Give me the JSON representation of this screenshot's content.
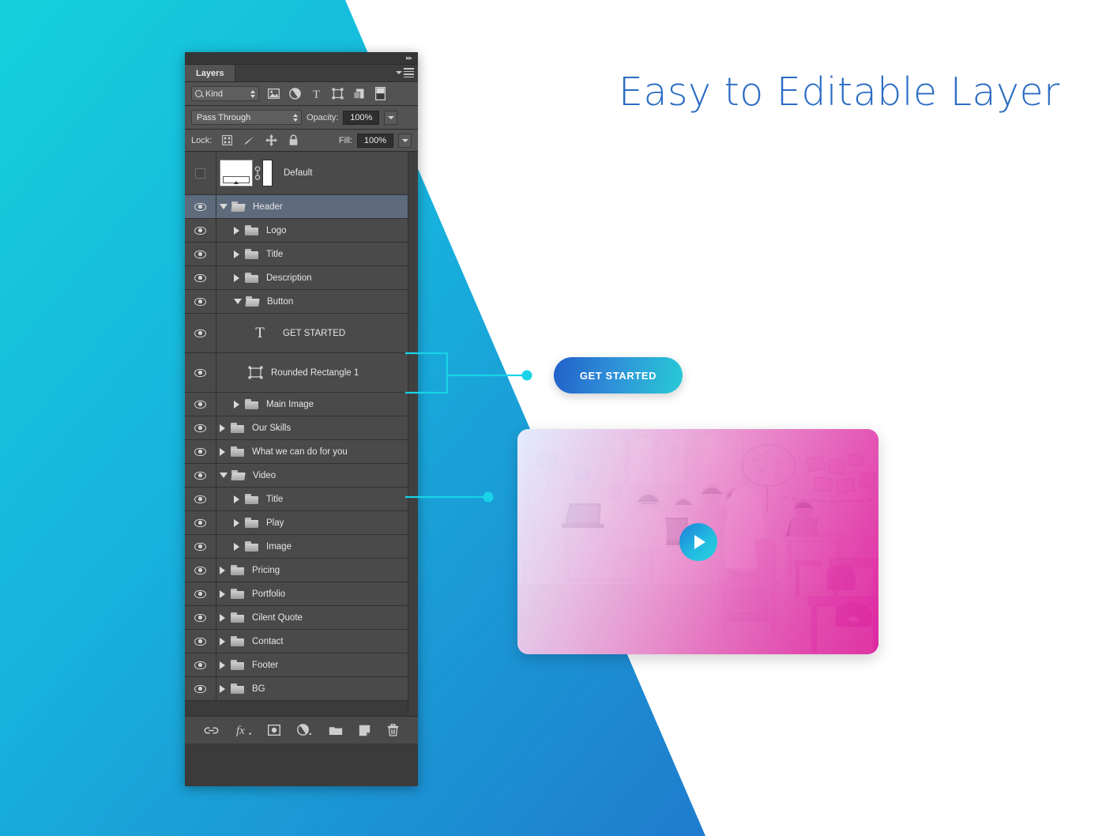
{
  "headline": "Easy to Editable Layer",
  "colors": {
    "accent_cyan": "#1ccfe0",
    "accent_blue": "#1f77cd",
    "headline_blue": "#2b6cc4",
    "panel_bg": "#3b3b3b",
    "row_bg": "#4a4a4a",
    "selected_row": "#5d6b7d",
    "pink": "#e322a0"
  },
  "panel": {
    "tab_label": "Layers",
    "expand_icon": "double-chevron-right-icon",
    "menu_icon": "panel-menu-icon",
    "filter": {
      "search_icon": "search-icon",
      "kind_label": "Kind",
      "stepper_icon": "stepper-arrows-icon",
      "icons": [
        "filter-pixel-icon",
        "filter-adjustment-icon",
        "filter-type-icon",
        "filter-shape-icon",
        "filter-smart-object-icon",
        "filter-toggle-icon"
      ]
    },
    "blend": {
      "mode": "Pass Through",
      "opacity_label": "Opacity:",
      "opacity_value": "100%",
      "dropdown_icon": "chevron-down-icon"
    },
    "lock": {
      "label": "Lock:",
      "icons": [
        "lock-transparent-pixels-icon",
        "lock-image-pixels-icon",
        "lock-position-icon",
        "lock-all-icon"
      ],
      "fill_label": "Fill:",
      "fill_value": "100%"
    },
    "toolbar_icons": [
      "link-layers-icon",
      "layer-style-fx-icon",
      "add-layer-mask-icon",
      "new-adjustment-layer-icon",
      "new-group-icon",
      "new-layer-icon",
      "delete-layer-icon"
    ]
  },
  "layers": [
    {
      "name": "Default",
      "indent": 0,
      "type": "artboard",
      "eye": false,
      "twirl": "none",
      "selected": false,
      "height": "first"
    },
    {
      "name": "Header",
      "indent": 0,
      "type": "group",
      "eye": true,
      "twirl": "open",
      "selected": true,
      "height": "normal"
    },
    {
      "name": "Logo",
      "indent": 1,
      "type": "group",
      "eye": true,
      "twirl": "closed",
      "selected": false,
      "height": "normal"
    },
    {
      "name": "Title",
      "indent": 1,
      "type": "group",
      "eye": true,
      "twirl": "closed",
      "selected": false,
      "height": "normal"
    },
    {
      "name": "Description",
      "indent": 1,
      "type": "group",
      "eye": true,
      "twirl": "closed",
      "selected": false,
      "height": "normal"
    },
    {
      "name": "Button",
      "indent": 1,
      "type": "group",
      "eye": true,
      "twirl": "open",
      "selected": false,
      "height": "normal"
    },
    {
      "name": "GET STARTED",
      "indent": 2,
      "type": "text",
      "eye": true,
      "twirl": "none",
      "selected": false,
      "height": "tall"
    },
    {
      "name": "Rounded Rectangle 1",
      "indent": 2,
      "type": "shape",
      "eye": true,
      "twirl": "none",
      "selected": false,
      "height": "tall"
    },
    {
      "name": "Main Image",
      "indent": 1,
      "type": "group",
      "eye": true,
      "twirl": "closed",
      "selected": false,
      "height": "normal"
    },
    {
      "name": "Our Skills",
      "indent": 0,
      "type": "group",
      "eye": true,
      "twirl": "closed",
      "selected": false,
      "height": "normal"
    },
    {
      "name": "What we can do for you",
      "indent": 0,
      "type": "group",
      "eye": true,
      "twirl": "closed",
      "selected": false,
      "height": "normal"
    },
    {
      "name": "Video",
      "indent": 0,
      "type": "group",
      "eye": true,
      "twirl": "open",
      "selected": false,
      "height": "normal"
    },
    {
      "name": "Title",
      "indent": 1,
      "type": "group",
      "eye": true,
      "twirl": "closed",
      "selected": false,
      "height": "normal"
    },
    {
      "name": "Play",
      "indent": 1,
      "type": "group",
      "eye": true,
      "twirl": "closed",
      "selected": false,
      "height": "normal"
    },
    {
      "name": "Image",
      "indent": 1,
      "type": "group",
      "eye": true,
      "twirl": "closed",
      "selected": false,
      "height": "normal"
    },
    {
      "name": "Pricing",
      "indent": 0,
      "type": "group",
      "eye": true,
      "twirl": "closed",
      "selected": false,
      "height": "normal"
    },
    {
      "name": "Portfolio",
      "indent": 0,
      "type": "group",
      "eye": true,
      "twirl": "closed",
      "selected": false,
      "height": "normal"
    },
    {
      "name": "Cilent Quote",
      "indent": 0,
      "type": "group",
      "eye": true,
      "twirl": "closed",
      "selected": false,
      "height": "normal"
    },
    {
      "name": "Contact",
      "indent": 0,
      "type": "group",
      "eye": true,
      "twirl": "closed",
      "selected": false,
      "height": "normal"
    },
    {
      "name": "Footer",
      "indent": 0,
      "type": "group",
      "eye": true,
      "twirl": "closed",
      "selected": false,
      "height": "normal"
    },
    {
      "name": "BG",
      "indent": 0,
      "type": "group",
      "eye": true,
      "twirl": "closed",
      "selected": false,
      "height": "normal"
    }
  ],
  "preview": {
    "button_label": "GET STARTED",
    "play_icon": "play-icon",
    "photo_alt": "classroom-students-laptops-photo"
  },
  "callouts": [
    {
      "name": "button-callout",
      "target": "GET STARTED / Rounded Rectangle 1"
    },
    {
      "name": "video-callout",
      "target": "Video"
    }
  ]
}
